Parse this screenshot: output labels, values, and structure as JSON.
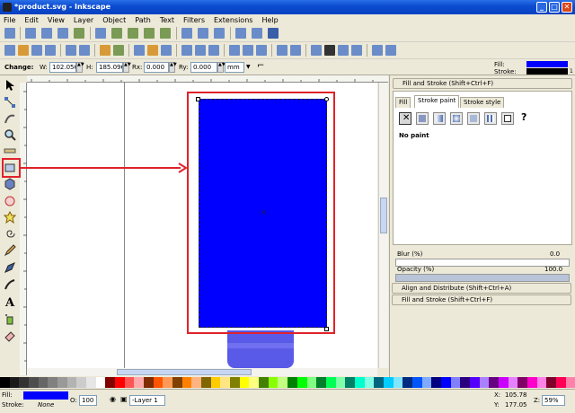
{
  "window": {
    "title": "*product.svg - Inkscape",
    "btn_min": "_",
    "btn_max": "□",
    "btn_close": "✕"
  },
  "menu": [
    "File",
    "Edit",
    "View",
    "Layer",
    "Object",
    "Path",
    "Text",
    "Filters",
    "Extensions",
    "Help"
  ],
  "controls": {
    "change_label": "Change:",
    "w_label": "W:",
    "w_value": "102.056",
    "h_label": "H:",
    "h_value": "185.096",
    "rx_label": "Rx:",
    "rx_value": "0.000",
    "ry_label": "Ry:",
    "ry_value": "0.000",
    "unit": "mm"
  },
  "indicator": {
    "fill_label": "Fill:",
    "stroke_label": "Stroke:",
    "stroke_width": "1"
  },
  "dock": {
    "panel_title": "Fill and Stroke (Shift+Ctrl+F)",
    "tabs": [
      "Fill",
      "Stroke paint",
      "Stroke style"
    ],
    "no_paint": "No paint",
    "unknown_mark": "?",
    "blur_label": "Blur (%)",
    "blur_value": "0.0",
    "opacity_label": "Opacity (%)",
    "opacity_value": "100.0",
    "collapsed_1": "Align and Distribute (Shift+Ctrl+A)",
    "collapsed_2": "Fill and Stroke (Shift+Ctrl+F)"
  },
  "status": {
    "fill_label": "Fill:",
    "stroke_label": "Stroke:",
    "stroke_value": "None",
    "opacity_label": "O:",
    "opacity_value": "100",
    "layer": "-Layer 1",
    "x_label": "X:",
    "x_value": "105.78",
    "y_label": "Y:",
    "y_value": "177.05",
    "zoom_label": "Z:",
    "zoom_value": "59%"
  },
  "colors": {
    "object_fill": "#0000ff",
    "annotation": "#e0222a",
    "titlebar": "#0a4bd0",
    "bottle": "#5a5ae8"
  },
  "palette": [
    "#000000",
    "#1a1a1a",
    "#333333",
    "#4d4d4d",
    "#666666",
    "#808080",
    "#999999",
    "#b3b3b3",
    "#cccccc",
    "#e6e6e6",
    "#ffffff",
    "#800000",
    "#ff0000",
    "#ff5555",
    "#ffaaaa",
    "#802b00",
    "#ff5500",
    "#ff9955",
    "#804000",
    "#ff8000",
    "#ffb380",
    "#806600",
    "#ffcc00",
    "#ffe680",
    "#808000",
    "#ffff00",
    "#ffff80",
    "#448000",
    "#88ff00",
    "#c3ff80",
    "#008000",
    "#00ff00",
    "#80ff80",
    "#00802b",
    "#00ff55",
    "#80ffaa",
    "#008066",
    "#00ffcc",
    "#80ffe6",
    "#006680",
    "#00ccff",
    "#80e6ff",
    "#002b80",
    "#0055ff",
    "#80aaff",
    "#000080",
    "#0000ff",
    "#8080ff",
    "#2b0080",
    "#5500ff",
    "#aa80ff",
    "#660080",
    "#cc00ff",
    "#e680ff",
    "#800066",
    "#ff00cc",
    "#ff80e6",
    "#80002b",
    "#ff0055",
    "#ff80aa"
  ]
}
